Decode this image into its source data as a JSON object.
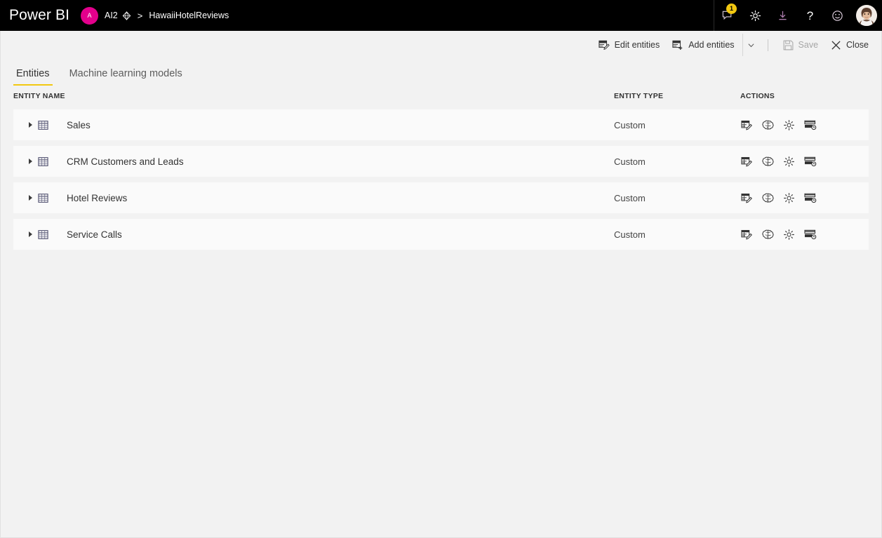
{
  "header": {
    "brand": "Power BI",
    "workspace_initial": "A",
    "workspace_name": "AI2",
    "premium_icon": "diamond-icon",
    "separator": ">",
    "dataflow_name": "HawaiiHotelReviews",
    "actions": [
      {
        "name": "notifications-icon",
        "label": "Notifications",
        "badge": "1"
      },
      {
        "name": "settings-gear-icon",
        "label": "Settings",
        "badge": ""
      },
      {
        "name": "download-icon",
        "label": "Download",
        "badge": ""
      },
      {
        "name": "help-icon",
        "label": "Help",
        "badge": ""
      },
      {
        "name": "feedback-smiley-icon",
        "label": "Feedback",
        "badge": ""
      }
    ],
    "avatar_alt": "User account"
  },
  "toolbar": {
    "edit_entities_label": "Edit entities",
    "add_entities_label": "Add entities",
    "add_entities_caret": "chevron-down-icon",
    "save_label": "Save",
    "save_disabled": true,
    "close_label": "Close"
  },
  "tabs": [
    {
      "label": "Entities",
      "active": true
    },
    {
      "label": "Machine learning models",
      "active": false
    }
  ],
  "table": {
    "columns": {
      "name": "ENTITY NAME",
      "type": "ENTITY TYPE",
      "actions": "ACTIONS"
    },
    "rows": [
      {
        "name": "Sales",
        "type": "Custom"
      },
      {
        "name": "CRM Customers and Leads",
        "type": "Custom"
      },
      {
        "name": "Hotel Reviews",
        "type": "Custom"
      },
      {
        "name": "Service Calls",
        "type": "Custom"
      }
    ],
    "row_actions": [
      {
        "name": "edit-entity-icon",
        "label": "Edit entity"
      },
      {
        "name": "ai-brain-icon",
        "label": "AI insights"
      },
      {
        "name": "entity-settings-icon",
        "label": "Settings"
      },
      {
        "name": "incremental-refresh-icon",
        "label": "Incremental refresh"
      }
    ]
  },
  "colors": {
    "accent_yellow": "#f2c811",
    "workspace_pink": "#e3008c",
    "header_black": "#000000",
    "page_background": "#f2f2f2",
    "row_background": "#fafafa"
  }
}
